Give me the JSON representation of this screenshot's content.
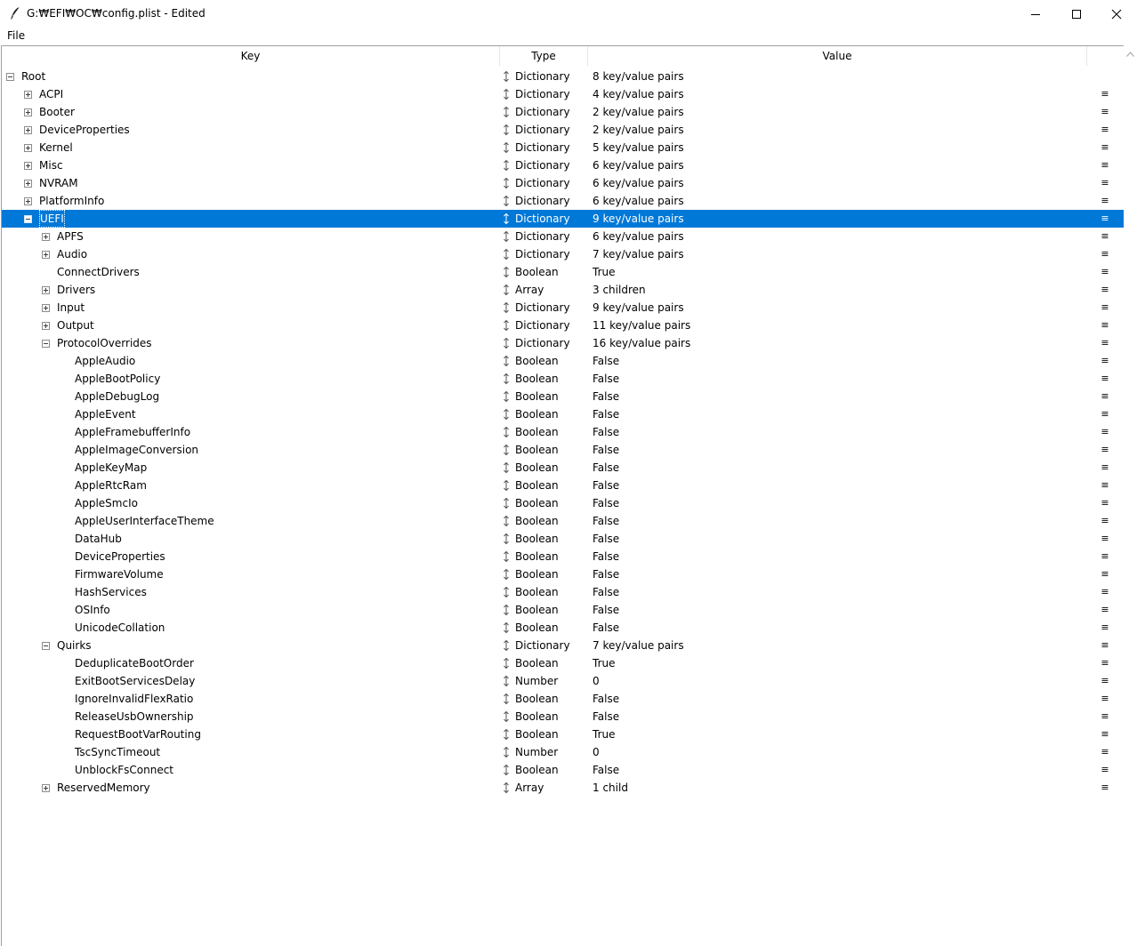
{
  "window": {
    "title": "G:₩EFI₩OC₩config.plist - Edited",
    "minimize_glyph": "minimize",
    "maximize_glyph": "maximize",
    "close_glyph": "close"
  },
  "menu": {
    "file_label": "File"
  },
  "columns": {
    "key": "Key",
    "type": "Type",
    "value": "Value"
  },
  "colors": {
    "selection": "#0078d7",
    "selection_text": "#ffffff",
    "border": "#a0a0a0"
  },
  "rows": [
    {
      "key": "Root",
      "type": "Dictionary",
      "value": "8 key/value pairs",
      "level": 0,
      "expander": "minus",
      "handle": ""
    },
    {
      "key": "ACPI",
      "type": "Dictionary",
      "value": "4 key/value pairs",
      "level": 1,
      "expander": "plus",
      "handle": "≡"
    },
    {
      "key": "Booter",
      "type": "Dictionary",
      "value": "2 key/value pairs",
      "level": 1,
      "expander": "plus",
      "handle": "≡"
    },
    {
      "key": "DeviceProperties",
      "type": "Dictionary",
      "value": "2 key/value pairs",
      "level": 1,
      "expander": "plus",
      "handle": "≡"
    },
    {
      "key": "Kernel",
      "type": "Dictionary",
      "value": "5 key/value pairs",
      "level": 1,
      "expander": "plus",
      "handle": "≡"
    },
    {
      "key": "Misc",
      "type": "Dictionary",
      "value": "6 key/value pairs",
      "level": 1,
      "expander": "plus",
      "handle": "≡"
    },
    {
      "key": "NVRAM",
      "type": "Dictionary",
      "value": "6 key/value pairs",
      "level": 1,
      "expander": "plus",
      "handle": "≡"
    },
    {
      "key": "PlatformInfo",
      "type": "Dictionary",
      "value": "6 key/value pairs",
      "level": 1,
      "expander": "plus",
      "handle": "≡"
    },
    {
      "key": "UEFI",
      "type": "Dictionary",
      "value": "9 key/value pairs",
      "level": 1,
      "expander": "minus",
      "handle": "≡",
      "selected": true
    },
    {
      "key": "APFS",
      "type": "Dictionary",
      "value": "6 key/value pairs",
      "level": 2,
      "expander": "plus",
      "handle": "≡"
    },
    {
      "key": "Audio",
      "type": "Dictionary",
      "value": "7 key/value pairs",
      "level": 2,
      "expander": "plus",
      "handle": "≡"
    },
    {
      "key": "ConnectDrivers",
      "type": "Boolean",
      "value": "True",
      "level": 2,
      "expander": "",
      "handle": "≡"
    },
    {
      "key": "Drivers",
      "type": "Array",
      "value": "3 children",
      "level": 2,
      "expander": "plus",
      "handle": "≡"
    },
    {
      "key": "Input",
      "type": "Dictionary",
      "value": "9 key/value pairs",
      "level": 2,
      "expander": "plus",
      "handle": "≡"
    },
    {
      "key": "Output",
      "type": "Dictionary",
      "value": "11 key/value pairs",
      "level": 2,
      "expander": "plus",
      "handle": "≡"
    },
    {
      "key": "ProtocolOverrides",
      "type": "Dictionary",
      "value": "16 key/value pairs",
      "level": 2,
      "expander": "minus",
      "handle": "≡"
    },
    {
      "key": "AppleAudio",
      "type": "Boolean",
      "value": "False",
      "level": 3,
      "expander": "",
      "handle": "≡"
    },
    {
      "key": "AppleBootPolicy",
      "type": "Boolean",
      "value": "False",
      "level": 3,
      "expander": "",
      "handle": "≡"
    },
    {
      "key": "AppleDebugLog",
      "type": "Boolean",
      "value": "False",
      "level": 3,
      "expander": "",
      "handle": "≡"
    },
    {
      "key": "AppleEvent",
      "type": "Boolean",
      "value": "False",
      "level": 3,
      "expander": "",
      "handle": "≡"
    },
    {
      "key": "AppleFramebufferInfo",
      "type": "Boolean",
      "value": "False",
      "level": 3,
      "expander": "",
      "handle": "≡"
    },
    {
      "key": "AppleImageConversion",
      "type": "Boolean",
      "value": "False",
      "level": 3,
      "expander": "",
      "handle": "≡"
    },
    {
      "key": "AppleKeyMap",
      "type": "Boolean",
      "value": "False",
      "level": 3,
      "expander": "",
      "handle": "≡"
    },
    {
      "key": "AppleRtcRam",
      "type": "Boolean",
      "value": "False",
      "level": 3,
      "expander": "",
      "handle": "≡"
    },
    {
      "key": "AppleSmcIo",
      "type": "Boolean",
      "value": "False",
      "level": 3,
      "expander": "",
      "handle": "≡"
    },
    {
      "key": "AppleUserInterfaceTheme",
      "type": "Boolean",
      "value": "False",
      "level": 3,
      "expander": "",
      "handle": "≡"
    },
    {
      "key": "DataHub",
      "type": "Boolean",
      "value": "False",
      "level": 3,
      "expander": "",
      "handle": "≡"
    },
    {
      "key": "DeviceProperties",
      "type": "Boolean",
      "value": "False",
      "level": 3,
      "expander": "",
      "handle": "≡"
    },
    {
      "key": "FirmwareVolume",
      "type": "Boolean",
      "value": "False",
      "level": 3,
      "expander": "",
      "handle": "≡"
    },
    {
      "key": "HashServices",
      "type": "Boolean",
      "value": "False",
      "level": 3,
      "expander": "",
      "handle": "≡"
    },
    {
      "key": "OSInfo",
      "type": "Boolean",
      "value": "False",
      "level": 3,
      "expander": "",
      "handle": "≡"
    },
    {
      "key": "UnicodeCollation",
      "type": "Boolean",
      "value": "False",
      "level": 3,
      "expander": "",
      "handle": "≡"
    },
    {
      "key": "Quirks",
      "type": "Dictionary",
      "value": "7 key/value pairs",
      "level": 2,
      "expander": "minus",
      "handle": "≡"
    },
    {
      "key": "DeduplicateBootOrder",
      "type": "Boolean",
      "value": "True",
      "level": 3,
      "expander": "",
      "handle": "≡"
    },
    {
      "key": "ExitBootServicesDelay",
      "type": "Number",
      "value": "0",
      "level": 3,
      "expander": "",
      "handle": "≡"
    },
    {
      "key": "IgnoreInvalidFlexRatio",
      "type": "Boolean",
      "value": "False",
      "level": 3,
      "expander": "",
      "handle": "≡"
    },
    {
      "key": "ReleaseUsbOwnership",
      "type": "Boolean",
      "value": "False",
      "level": 3,
      "expander": "",
      "handle": "≡"
    },
    {
      "key": "RequestBootVarRouting",
      "type": "Boolean",
      "value": "True",
      "level": 3,
      "expander": "",
      "handle": "≡"
    },
    {
      "key": "TscSyncTimeout",
      "type": "Number",
      "value": "0",
      "level": 3,
      "expander": "",
      "handle": "≡"
    },
    {
      "key": "UnblockFsConnect",
      "type": "Boolean",
      "value": "False",
      "level": 3,
      "expander": "",
      "handle": "≡"
    },
    {
      "key": "ReservedMemory",
      "type": "Array",
      "value": "1 child",
      "level": 2,
      "expander": "plus",
      "handle": "≡"
    }
  ]
}
